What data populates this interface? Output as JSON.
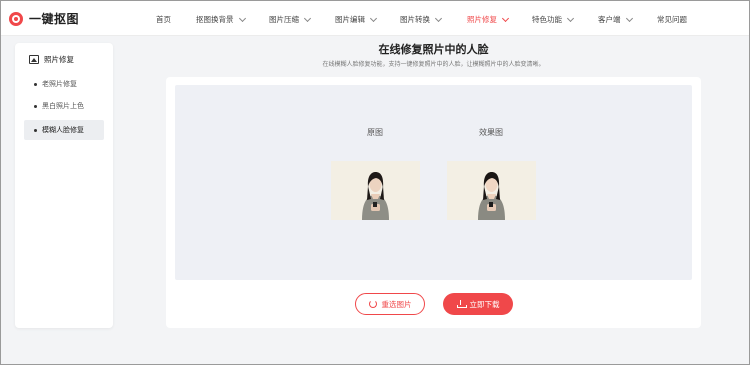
{
  "brand": {
    "name": "一键抠图"
  },
  "nav": {
    "items": [
      {
        "label": "首页",
        "has_dropdown": false
      },
      {
        "label": "抠图换背景",
        "has_dropdown": true
      },
      {
        "label": "图片压缩",
        "has_dropdown": true
      },
      {
        "label": "图片编辑",
        "has_dropdown": true
      },
      {
        "label": "图片转换",
        "has_dropdown": true
      },
      {
        "label": "照片修复",
        "has_dropdown": true,
        "active": true
      },
      {
        "label": "特色功能",
        "has_dropdown": true
      },
      {
        "label": "客户端",
        "has_dropdown": true
      },
      {
        "label": "常见问题",
        "has_dropdown": false
      }
    ]
  },
  "sidebar": {
    "title": "照片修复",
    "items": [
      {
        "label": "老照片修复"
      },
      {
        "label": "黑白照片上色"
      },
      {
        "label": "模糊人脸修复",
        "active": true
      }
    ]
  },
  "main": {
    "title": "在线修复照片中的人脸",
    "subtitle": "在线模糊人脸修复功能，支持一键修复照片中的人脸，让模糊照片中的人脸变清晰。",
    "original_label": "原图",
    "result_label": "效果图",
    "reselect_label": "重选图片",
    "download_label": "立即下载"
  },
  "colors": {
    "accent": "#f0484a",
    "preview_bg": "#eef0f5",
    "page_bg": "#f3f4f6"
  }
}
